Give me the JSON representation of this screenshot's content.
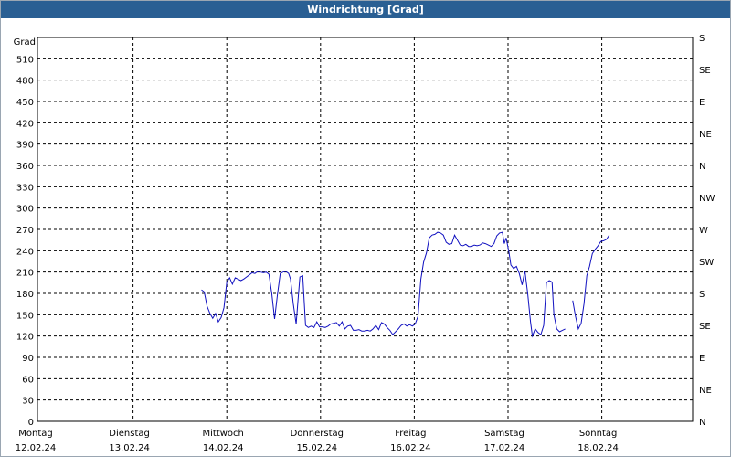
{
  "window": {
    "title": "Windrichtung [Grad]"
  },
  "chart_data": {
    "type": "line",
    "title": "Windrichtung [Grad]",
    "ylabel": "Grad",
    "ylim": [
      0,
      540
    ],
    "yticks": [
      0,
      30,
      60,
      90,
      120,
      150,
      180,
      210,
      240,
      270,
      300,
      330,
      360,
      390,
      420,
      450,
      480,
      510
    ],
    "y2_labels": [
      {
        "value": 0,
        "label": "N"
      },
      {
        "value": 45,
        "label": "NE"
      },
      {
        "value": 90,
        "label": "E"
      },
      {
        "value": 135,
        "label": "SE"
      },
      {
        "value": 180,
        "label": "S"
      },
      {
        "value": 225,
        "label": "SW"
      },
      {
        "value": 270,
        "label": "W"
      },
      {
        "value": 315,
        "label": "NW"
      },
      {
        "value": 360,
        "label": "N"
      },
      {
        "value": 405,
        "label": "NE"
      },
      {
        "value": 450,
        "label": "E"
      },
      {
        "value": 495,
        "label": "SE"
      },
      {
        "value": 540,
        "label": "S"
      }
    ],
    "xlim": [
      0,
      7
    ],
    "x_categories": [
      {
        "day": "Montag",
        "date": "12.02.24"
      },
      {
        "day": "Dienstag",
        "date": "13.02.24"
      },
      {
        "day": "Mittwoch",
        "date": "14.02.24"
      },
      {
        "day": "Donnerstag",
        "date": "15.02.24"
      },
      {
        "day": "Freitag",
        "date": "16.02.24"
      },
      {
        "day": "Samstag",
        "date": "17.02.24"
      },
      {
        "day": "Sonntag",
        "date": "18.02.24"
      }
    ],
    "grid": true,
    "color": "#1010c0",
    "segments": [
      [
        [
          1.72,
          185
        ],
        [
          1.75,
          182
        ],
        [
          1.78,
          162
        ],
        [
          1.81,
          152
        ],
        [
          1.84,
          145
        ],
        [
          1.87,
          152
        ],
        [
          1.9,
          140
        ],
        [
          1.93,
          146
        ],
        [
          1.96,
          160
        ],
        [
          1.99,
          196
        ],
        [
          2.02,
          202
        ],
        [
          2.05,
          193
        ],
        [
          2.08,
          202
        ],
        [
          2.11,
          200
        ],
        [
          2.14,
          198
        ],
        [
          2.17,
          200
        ],
        [
          2.2,
          203
        ],
        [
          2.23,
          206
        ],
        [
          2.26,
          209
        ],
        [
          2.29,
          208
        ],
        [
          2.32,
          211
        ],
        [
          2.35,
          210
        ],
        [
          2.38,
          209
        ],
        [
          2.41,
          210
        ],
        [
          2.44,
          207
        ],
        [
          2.47,
          180
        ],
        [
          2.5,
          144
        ],
        [
          2.53,
          178
        ],
        [
          2.56,
          208
        ],
        [
          2.59,
          210
        ],
        [
          2.62,
          211
        ],
        [
          2.65,
          208
        ],
        [
          2.67,
          200
        ],
        [
          2.7,
          165
        ],
        [
          2.73,
          137
        ],
        [
          2.75,
          170
        ],
        [
          2.77,
          203
        ],
        [
          2.8,
          205
        ],
        [
          2.83,
          135
        ],
        [
          2.86,
          132
        ],
        [
          2.89,
          134
        ],
        [
          2.92,
          132
        ],
        [
          2.95,
          140
        ],
        [
          2.98,
          133
        ],
        [
          3.01,
          133
        ],
        [
          3.04,
          132
        ],
        [
          3.07,
          134
        ],
        [
          3.1,
          137
        ],
        [
          3.13,
          138
        ],
        [
          3.16,
          139
        ],
        [
          3.19,
          134
        ],
        [
          3.22,
          140
        ],
        [
          3.25,
          130
        ],
        [
          3.28,
          134
        ],
        [
          3.31,
          135
        ],
        [
          3.34,
          128
        ],
        [
          3.37,
          128
        ],
        [
          3.4,
          129
        ],
        [
          3.43,
          127
        ],
        [
          3.46,
          127
        ],
        [
          3.49,
          128
        ],
        [
          3.52,
          127
        ],
        [
          3.55,
          130
        ],
        [
          3.58,
          135
        ],
        [
          3.61,
          129
        ],
        [
          3.64,
          139
        ],
        [
          3.67,
          137
        ],
        [
          3.7,
          132
        ],
        [
          3.73,
          128
        ],
        [
          3.76,
          122
        ],
        [
          3.79,
          126
        ],
        [
          3.82,
          130
        ],
        [
          3.85,
          135
        ],
        [
          3.88,
          137
        ],
        [
          3.91,
          134
        ],
        [
          3.94,
          136
        ],
        [
          3.97,
          134
        ],
        [
          4.0,
          137
        ],
        [
          4.03,
          148
        ],
        [
          4.06,
          200
        ],
        [
          4.09,
          224
        ],
        [
          4.12,
          237
        ],
        [
          4.15,
          258
        ],
        [
          4.18,
          262
        ],
        [
          4.21,
          263
        ],
        [
          4.24,
          266
        ],
        [
          4.27,
          265
        ],
        [
          4.3,
          262
        ],
        [
          4.33,
          252
        ],
        [
          4.36,
          249
        ],
        [
          4.39,
          250
        ],
        [
          4.42,
          262
        ],
        [
          4.45,
          255
        ],
        [
          4.48,
          248
        ],
        [
          4.51,
          247
        ],
        [
          4.54,
          249
        ],
        [
          4.57,
          246
        ],
        [
          4.6,
          246
        ],
        [
          4.63,
          248
        ],
        [
          4.66,
          247
        ],
        [
          4.69,
          248
        ],
        [
          4.72,
          251
        ],
        [
          4.75,
          250
        ],
        [
          4.78,
          248
        ],
        [
          4.81,
          246
        ],
        [
          4.84,
          250
        ],
        [
          4.87,
          261
        ],
        [
          4.9,
          265
        ],
        [
          4.93,
          266
        ],
        [
          4.95,
          250
        ],
        [
          4.97,
          258
        ],
        [
          5.0,
          238
        ],
        [
          5.02,
          220
        ],
        [
          5.05,
          215
        ],
        [
          5.08,
          218
        ],
        [
          5.11,
          208
        ],
        [
          5.14,
          192
        ],
        [
          5.17,
          212
        ],
        [
          5.2,
          180
        ],
        [
          5.23,
          140
        ],
        [
          5.25,
          120
        ],
        [
          5.28,
          130
        ],
        [
          5.31,
          125
        ],
        [
          5.34,
          122
        ],
        [
          5.37,
          135
        ],
        [
          5.4,
          195
        ],
        [
          5.43,
          198
        ],
        [
          5.46,
          196
        ],
        [
          5.48,
          150
        ],
        [
          5.51,
          130
        ],
        [
          5.54,
          126
        ],
        [
          5.57,
          128
        ],
        [
          5.6,
          130
        ]
      ],
      [
        [
          5.68,
          170
        ],
        [
          5.71,
          148
        ],
        [
          5.74,
          130
        ],
        [
          5.77,
          138
        ],
        [
          5.8,
          165
        ],
        [
          5.83,
          205
        ],
        [
          5.86,
          218
        ],
        [
          5.89,
          236
        ],
        [
          5.92,
          242
        ],
        [
          5.95,
          247
        ],
        [
          5.98,
          253
        ],
        [
          6.01,
          254
        ],
        [
          6.04,
          256
        ],
        [
          6.07,
          262
        ]
      ]
    ]
  }
}
